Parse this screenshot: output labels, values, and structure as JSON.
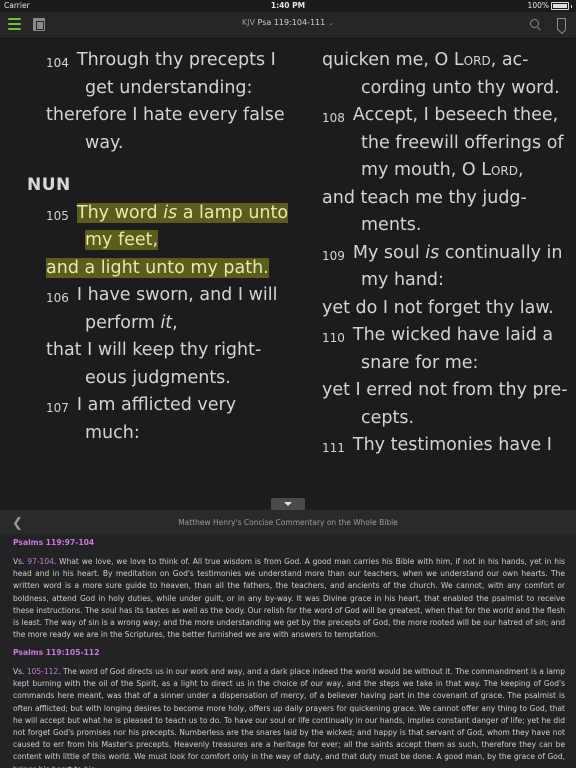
{
  "status": {
    "carrier": "Carrier",
    "time": "1:40 PM",
    "battery": "100%"
  },
  "toolbar": {
    "version": "KJV",
    "reference": "Psa 119:104-111"
  },
  "bible": {
    "left": {
      "v104_num": "104",
      "v104_l1": "Through thy precepts I",
      "v104_l2": "get understanding:",
      "v104_l3": "therefore I hate every false",
      "v104_l4": "way.",
      "heading": "NUN",
      "v105_num": "105",
      "v105_l1a": "Thy word ",
      "v105_l1b": "is",
      "v105_l1c": " a lamp unto",
      "v105_l2": "my feet,",
      "v105_l3": "and a light unto my path.",
      "v106_num": "106",
      "v106_l1": "I have sworn, and I will",
      "v106_l2a": "perform ",
      "v106_l2b": "it",
      "v106_l2c": ",",
      "v106_l3": "that I will keep thy right-",
      "v106_l4": "eous judgments.",
      "v107_num": "107",
      "v107_l1": "I am afflicted very",
      "v107_l2": "much:"
    },
    "right": {
      "c1a": "quicken me, O ",
      "c1b": "Lord",
      "c1c": ", ac-",
      "c2": "cording unto thy word.",
      "v108_num": "108",
      "v108_l1": "Accept, I beseech thee,",
      "v108_l2": "the freewill offerings of",
      "v108_l3a": "my mouth, O ",
      "v108_l3b": "Lord",
      "v108_l3c": ",",
      "v108_l4": "and teach me thy judg-",
      "v108_l5": "ments.",
      "v109_num": "109",
      "v109_l1a": "My soul ",
      "v109_l1b": "is",
      "v109_l1c": " continually in",
      "v109_l2": "my hand:",
      "v109_l3": "yet do I not forget thy law.",
      "v110_num": "110",
      "v110_l1": "The wicked have laid a",
      "v110_l2": "snare for me:",
      "v110_l3": "yet I erred not from thy pre-",
      "v110_l4": "cepts.",
      "v111_num": "111",
      "v111_l1": "Thy testimonies have I"
    }
  },
  "commentary": {
    "title": "Matthew Henry's Concise Commentary on the Whole Bible",
    "sec1": {
      "title": "Psalms 119:97-104",
      "prefix": "Vs. ",
      "link": "97-104",
      "text": ". What we love, we love to think of. All true wisdom is from God. A good man carries his Bible with him, if not in his hands, yet in his head and in his heart. By meditation on God's testimonies we understand more than our teachers, when we understand our own hearts. The written word is a more sure guide to heaven, than all the fathers, the teachers, and ancients of the church. We cannot, with any comfort or boldness, attend God in holy duties, while under guilt, or in any by-way. It was Divine grace in his heart, that enabled the psalmist to receive these instructions. The soul has its tastes as well as the body. Our relish for the word of God will be greatest, when that for the world and the flesh is least. The way of sin is a wrong way; and the more understanding we get by the precepts of God, the more rooted will be our hatred of sin; and the more ready we are in the Scriptures, the better furnished we are with answers to temptation."
    },
    "sec2": {
      "title": "Psalms 119:105-112",
      "prefix": "Vs. ",
      "link": "105-112",
      "text": ". The word of God directs us in our work and way, and a dark place indeed the world would be without it. The commandment is a lamp kept burning with the oil of the Spirit, as a light to direct us in the choice of our way, and the steps we take in that way. The keeping of God's commands here meant, was that of a sinner under a dispensation of mercy, of a believer having part in the covenant of grace. The psalmist is often afflicted; but with longing desires to become more holy, offers up daily prayers for quickening grace. We cannot offer any thing to God, that he will accept but what he is pleased to teach us to do. To have our soul or life continually in our hands, implies constant danger of life; yet he did not forget God's promises nor his precepts. Numberless are the snares laid by the wicked; and happy is that servant of God, whom they have not caused to err from his Master's precepts. Heavenly treasures are a heritage for ever; all the saints accept them as such, therefore they can be content with little of this world. We must look for comfort only in the way of duty, and that duty must be done. A good man, by the grace of God, brings his heart to his"
    }
  }
}
